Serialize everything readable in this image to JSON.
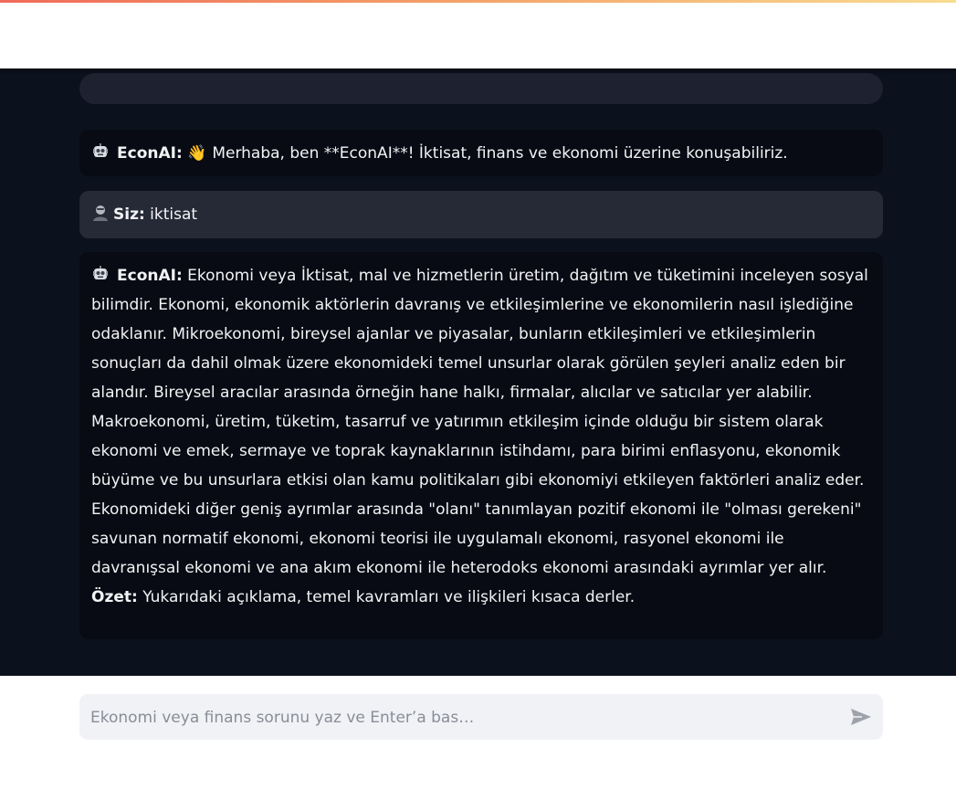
{
  "colors": {
    "chat_background": "#0b111d",
    "bot_bubble": "#080b13",
    "user_bubble": "#262a37",
    "input_background": "#f0f2f6"
  },
  "messages": [
    {
      "role": "bot",
      "avatar_icon": "robot-icon",
      "sender": "EconAI:",
      "wave_icon": "👋",
      "text": "Merhaba, ben **EconAI**! İktisat, finans ve ekonomi üzerine konuşabiliriz."
    },
    {
      "role": "user",
      "avatar_icon": "user-icon",
      "sender": "Siz:",
      "text": "iktisat"
    },
    {
      "role": "bot",
      "avatar_icon": "robot-icon",
      "sender": "EconAI:",
      "text": "Ekonomi veya İktisat, mal ve hizmetlerin üretim, dağıtım ve tüketimini inceleyen sosyal bilimdir. Ekonomi, ekonomik aktörlerin davranış ve etkileşimlerine ve ekonomilerin nasıl işlediğine odaklanır. Mikroekonomi, bireysel ajanlar ve piyasalar, bunların etkileşimleri ve etkileşimlerin sonuçları da dahil olmak üzere ekonomideki temel unsurlar olarak görülen şeyleri analiz eden bir alandır. Bireysel aracılar arasında örneğin hane halkı, firmalar, alıcılar ve satıcılar yer alabilir. Makroekonomi, üretim, tüketim, tasarruf ve yatırımın etkileşim içinde olduğu bir sistem olarak ekonomi ve emek, sermaye ve toprak kaynaklarının istihdamı, para birimi enflasyonu, ekonomik büyüme ve bu unsurlara etkisi olan kamu politikaları gibi ekonomiyi etkileyen faktörleri analiz eder. Ekonomideki diğer geniş ayrımlar arasında \"olanı\" tanımlayan pozitif ekonomi ile \"olması gerekeni\" savunan normatif ekonomi, ekonomi teorisi ile uygulamalı ekonomi, rasyonel ekonomi ile davranışsal ekonomi ve ana akım ekonomi ile heterodoks ekonomi arasındaki ayrımlar yer alır.",
      "summary_label": "Özet:",
      "summary_text": "Yukarıdaki açıklama, temel kavramları ve ilişkileri kısaca derler."
    }
  ],
  "input": {
    "placeholder": "Ekonomi veya finans sorunu yaz ve Enter’a bas…",
    "value": "",
    "send_icon": "send-icon"
  }
}
